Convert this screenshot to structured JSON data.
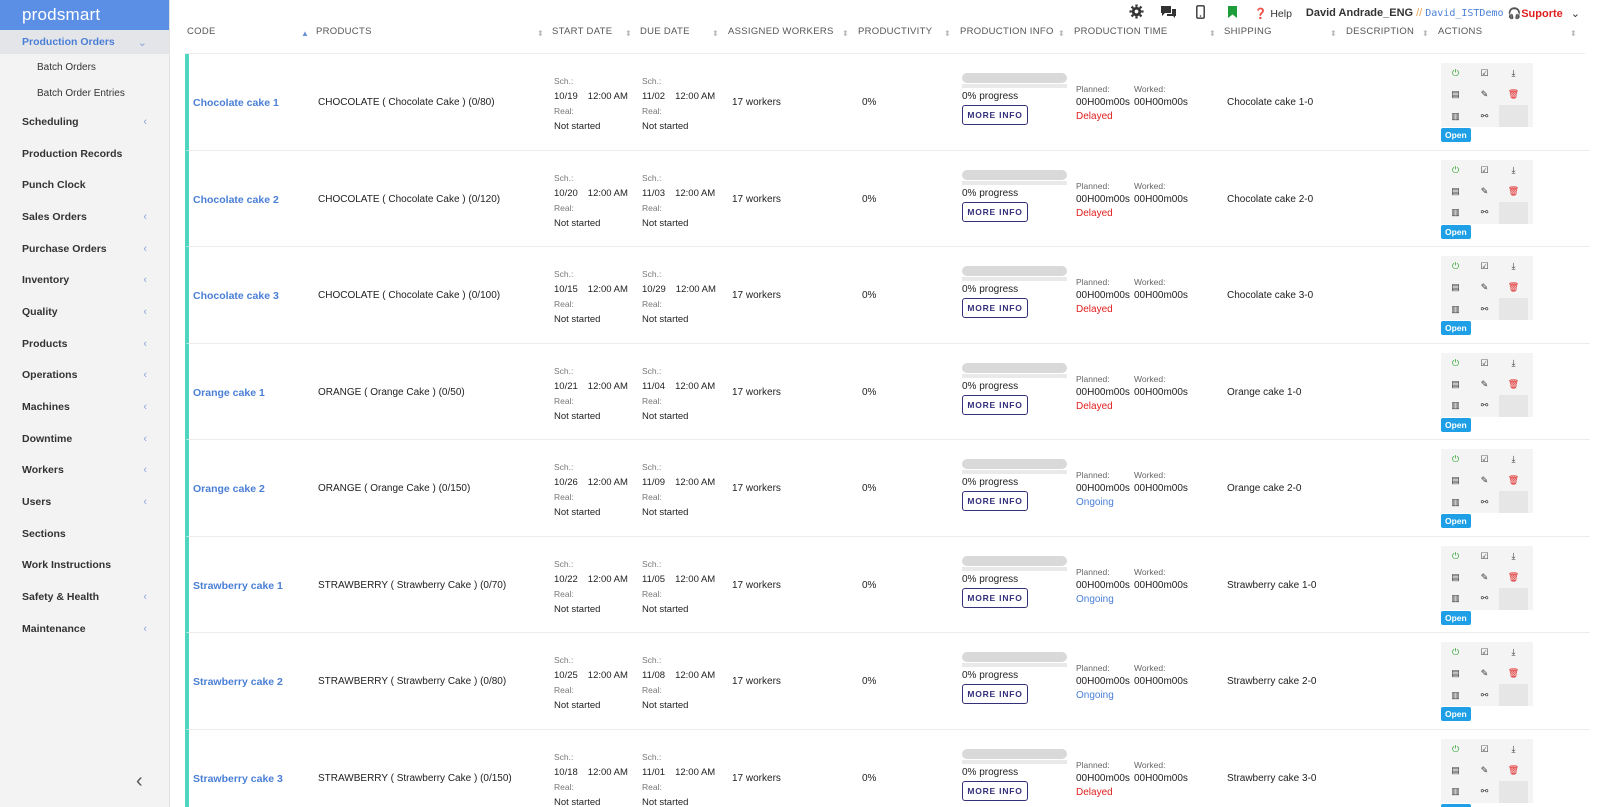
{
  "app": {
    "brand": "prodsmart"
  },
  "sidebar": {
    "active": {
      "label": "Production Orders",
      "chevron": "⌄"
    },
    "subitems": [
      {
        "label": "Batch Orders"
      },
      {
        "label": "Batch Order Entries"
      }
    ],
    "items": [
      {
        "label": "Scheduling",
        "chev": "‹"
      },
      {
        "label": "Production Records",
        "chev": ""
      },
      {
        "label": "Punch Clock",
        "chev": ""
      },
      {
        "label": "Sales Orders",
        "chev": "‹"
      },
      {
        "label": "Purchase Orders",
        "chev": "‹"
      },
      {
        "label": "Inventory",
        "chev": "‹"
      },
      {
        "label": "Quality",
        "chev": "‹"
      },
      {
        "label": "Products",
        "chev": "‹"
      },
      {
        "label": "Operations",
        "chev": "‹"
      },
      {
        "label": "Machines",
        "chev": "‹"
      },
      {
        "label": "Downtime",
        "chev": "‹"
      },
      {
        "label": "Workers",
        "chev": "‹"
      },
      {
        "label": "Users",
        "chev": "‹"
      },
      {
        "label": "Sections",
        "chev": ""
      },
      {
        "label": "Work Instructions",
        "chev": ""
      },
      {
        "label": "Safety & Health",
        "chev": "‹"
      },
      {
        "label": "Maintenance",
        "chev": "‹"
      }
    ],
    "collapse": "‹"
  },
  "topbar": {
    "icons": [
      "gear-icon",
      "chat-icon",
      "mobile-icon",
      "bookmark-icon"
    ],
    "help": "Help",
    "user": "David Andrade_ENG",
    "sep": "//",
    "demo": "David_ISTDemo",
    "support": "Suporte",
    "caret": "⌄"
  },
  "table": {
    "headers": [
      "CODE",
      "PRODUCTS",
      "START DATE",
      "DUE DATE",
      "ASSIGNED WORKERS",
      "PRODUCTIVITY",
      "PRODUCTION INFO",
      "PRODUCTION TIME",
      "SHIPPING",
      "DESCRIPTION",
      "ACTIONS"
    ],
    "labels": {
      "sch": "Sch.:",
      "real": "Real:",
      "planned": "Planned:",
      "worked": "Worked:",
      "more_info": "MORE INFO",
      "open": "Open"
    },
    "rows": [
      {
        "code": "Chocolate cake 1",
        "product": "CHOCOLATE ( Chocolate Cake ) (0/80)",
        "start": "10/19",
        "start_time": "12:00 AM",
        "start_real": "Not started",
        "due": "11/02",
        "due_time": "12:00 AM",
        "due_real": "Not started",
        "workers": "17 workers",
        "productivity": "0%",
        "progress": "0% progress",
        "planned": "00H00m00s",
        "worked": "00H00m00s",
        "status": "Delayed",
        "status_type": "delayed",
        "shipping": "Chocolate cake 1-0"
      },
      {
        "code": "Chocolate cake 2",
        "product": "CHOCOLATE ( Chocolate Cake ) (0/120)",
        "start": "10/20",
        "start_time": "12:00 AM",
        "start_real": "Not started",
        "due": "11/03",
        "due_time": "12:00 AM",
        "due_real": "Not started",
        "workers": "17 workers",
        "productivity": "0%",
        "progress": "0% progress",
        "planned": "00H00m00s",
        "worked": "00H00m00s",
        "status": "Delayed",
        "status_type": "delayed",
        "shipping": "Chocolate cake 2-0"
      },
      {
        "code": "Chocolate cake 3",
        "product": "CHOCOLATE ( Chocolate Cake ) (0/100)",
        "start": "10/15",
        "start_time": "12:00 AM",
        "start_real": "Not started",
        "due": "10/29",
        "due_time": "12:00 AM",
        "due_real": "Not started",
        "workers": "17 workers",
        "productivity": "0%",
        "progress": "0% progress",
        "planned": "00H00m00s",
        "worked": "00H00m00s",
        "status": "Delayed",
        "status_type": "delayed",
        "shipping": "Chocolate cake 3-0"
      },
      {
        "code": "Orange cake 1",
        "product": "ORANGE ( Orange Cake ) (0/50)",
        "start": "10/21",
        "start_time": "12:00 AM",
        "start_real": "Not started",
        "due": "11/04",
        "due_time": "12:00 AM",
        "due_real": "Not started",
        "workers": "17 workers",
        "productivity": "0%",
        "progress": "0% progress",
        "planned": "00H00m00s",
        "worked": "00H00m00s",
        "status": "Delayed",
        "status_type": "delayed",
        "shipping": "Orange cake 1-0"
      },
      {
        "code": "Orange cake 2",
        "product": "ORANGE ( Orange Cake ) (0/150)",
        "start": "10/26",
        "start_time": "12:00 AM",
        "start_real": "Not started",
        "due": "11/09",
        "due_time": "12:00 AM",
        "due_real": "Not started",
        "workers": "17 workers",
        "productivity": "0%",
        "progress": "0% progress",
        "planned": "00H00m00s",
        "worked": "00H00m00s",
        "status": "Ongoing",
        "status_type": "ongoing",
        "shipping": "Orange cake 2-0"
      },
      {
        "code": "Strawberry cake 1",
        "product": "STRAWBERRY ( Strawberry Cake ) (0/70)",
        "start": "10/22",
        "start_time": "12:00 AM",
        "start_real": "Not started",
        "due": "11/05",
        "due_time": "12:00 AM",
        "due_real": "Not started",
        "workers": "17 workers",
        "productivity": "0%",
        "progress": "0% progress",
        "planned": "00H00m00s",
        "worked": "00H00m00s",
        "status": "Ongoing",
        "status_type": "ongoing",
        "shipping": "Strawberry cake 1-0"
      },
      {
        "code": "Strawberry cake 2",
        "product": "STRAWBERRY ( Strawberry Cake ) (0/80)",
        "start": "10/25",
        "start_time": "12:00 AM",
        "start_real": "Not started",
        "due": "11/08",
        "due_time": "12:00 AM",
        "due_real": "Not started",
        "workers": "17 workers",
        "productivity": "0%",
        "progress": "0% progress",
        "planned": "00H00m00s",
        "worked": "00H00m00s",
        "status": "Ongoing",
        "status_type": "ongoing",
        "shipping": "Strawberry cake 2-0"
      },
      {
        "code": "Strawberry cake 3",
        "product": "STRAWBERRY ( Strawberry Cake ) (0/150)",
        "start": "10/18",
        "start_time": "12:00 AM",
        "start_real": "Not started",
        "due": "11/01",
        "due_time": "12:00 AM",
        "due_real": "Not started",
        "workers": "17 workers",
        "productivity": "0%",
        "progress": "0% progress",
        "planned": "00H00m00s",
        "worked": "00H00m00s",
        "status": "Delayed",
        "status_type": "delayed",
        "shipping": "Strawberry cake 3-0"
      }
    ]
  }
}
